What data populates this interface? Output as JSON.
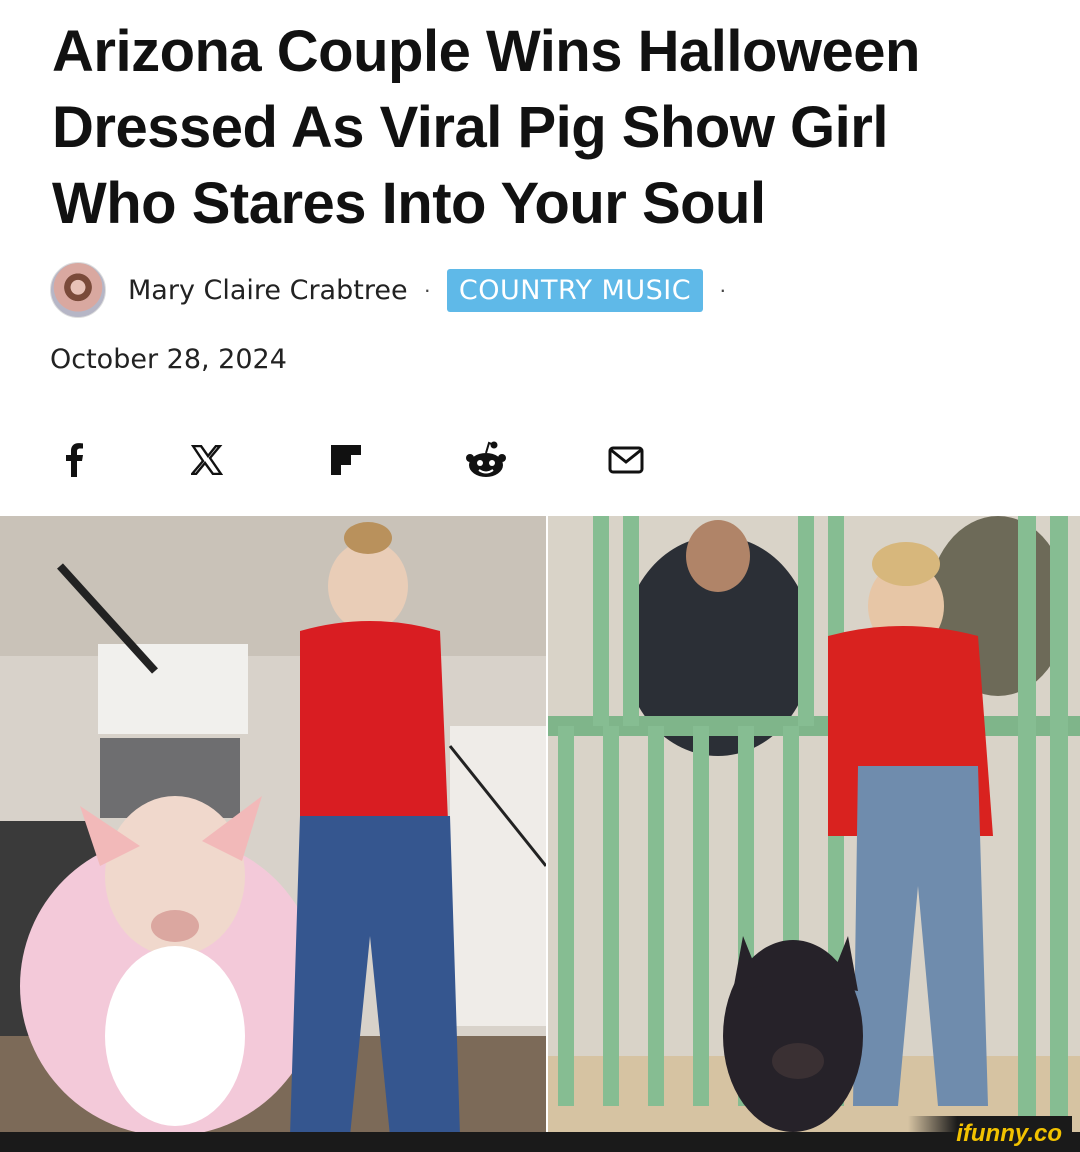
{
  "article": {
    "headline_lines": [
      "Arizona Couple Wins Halloween",
      "Dressed As Viral Pig Show Girl",
      "Who Stares Into Your Soul"
    ],
    "author": "Mary Claire Crabtree",
    "separator": "·",
    "category": "COUNTRY MUSIC",
    "date": "October 28, 2024"
  },
  "share": {
    "icons": [
      "facebook-icon",
      "x-icon",
      "flipboard-icon",
      "reddit-icon",
      "email-icon"
    ]
  },
  "watermark": {
    "text": "ifunny.co"
  },
  "colors": {
    "category_bg": "#5fb9e8",
    "watermark": "#f2c200",
    "footer_bar": "#1a1a1a"
  }
}
